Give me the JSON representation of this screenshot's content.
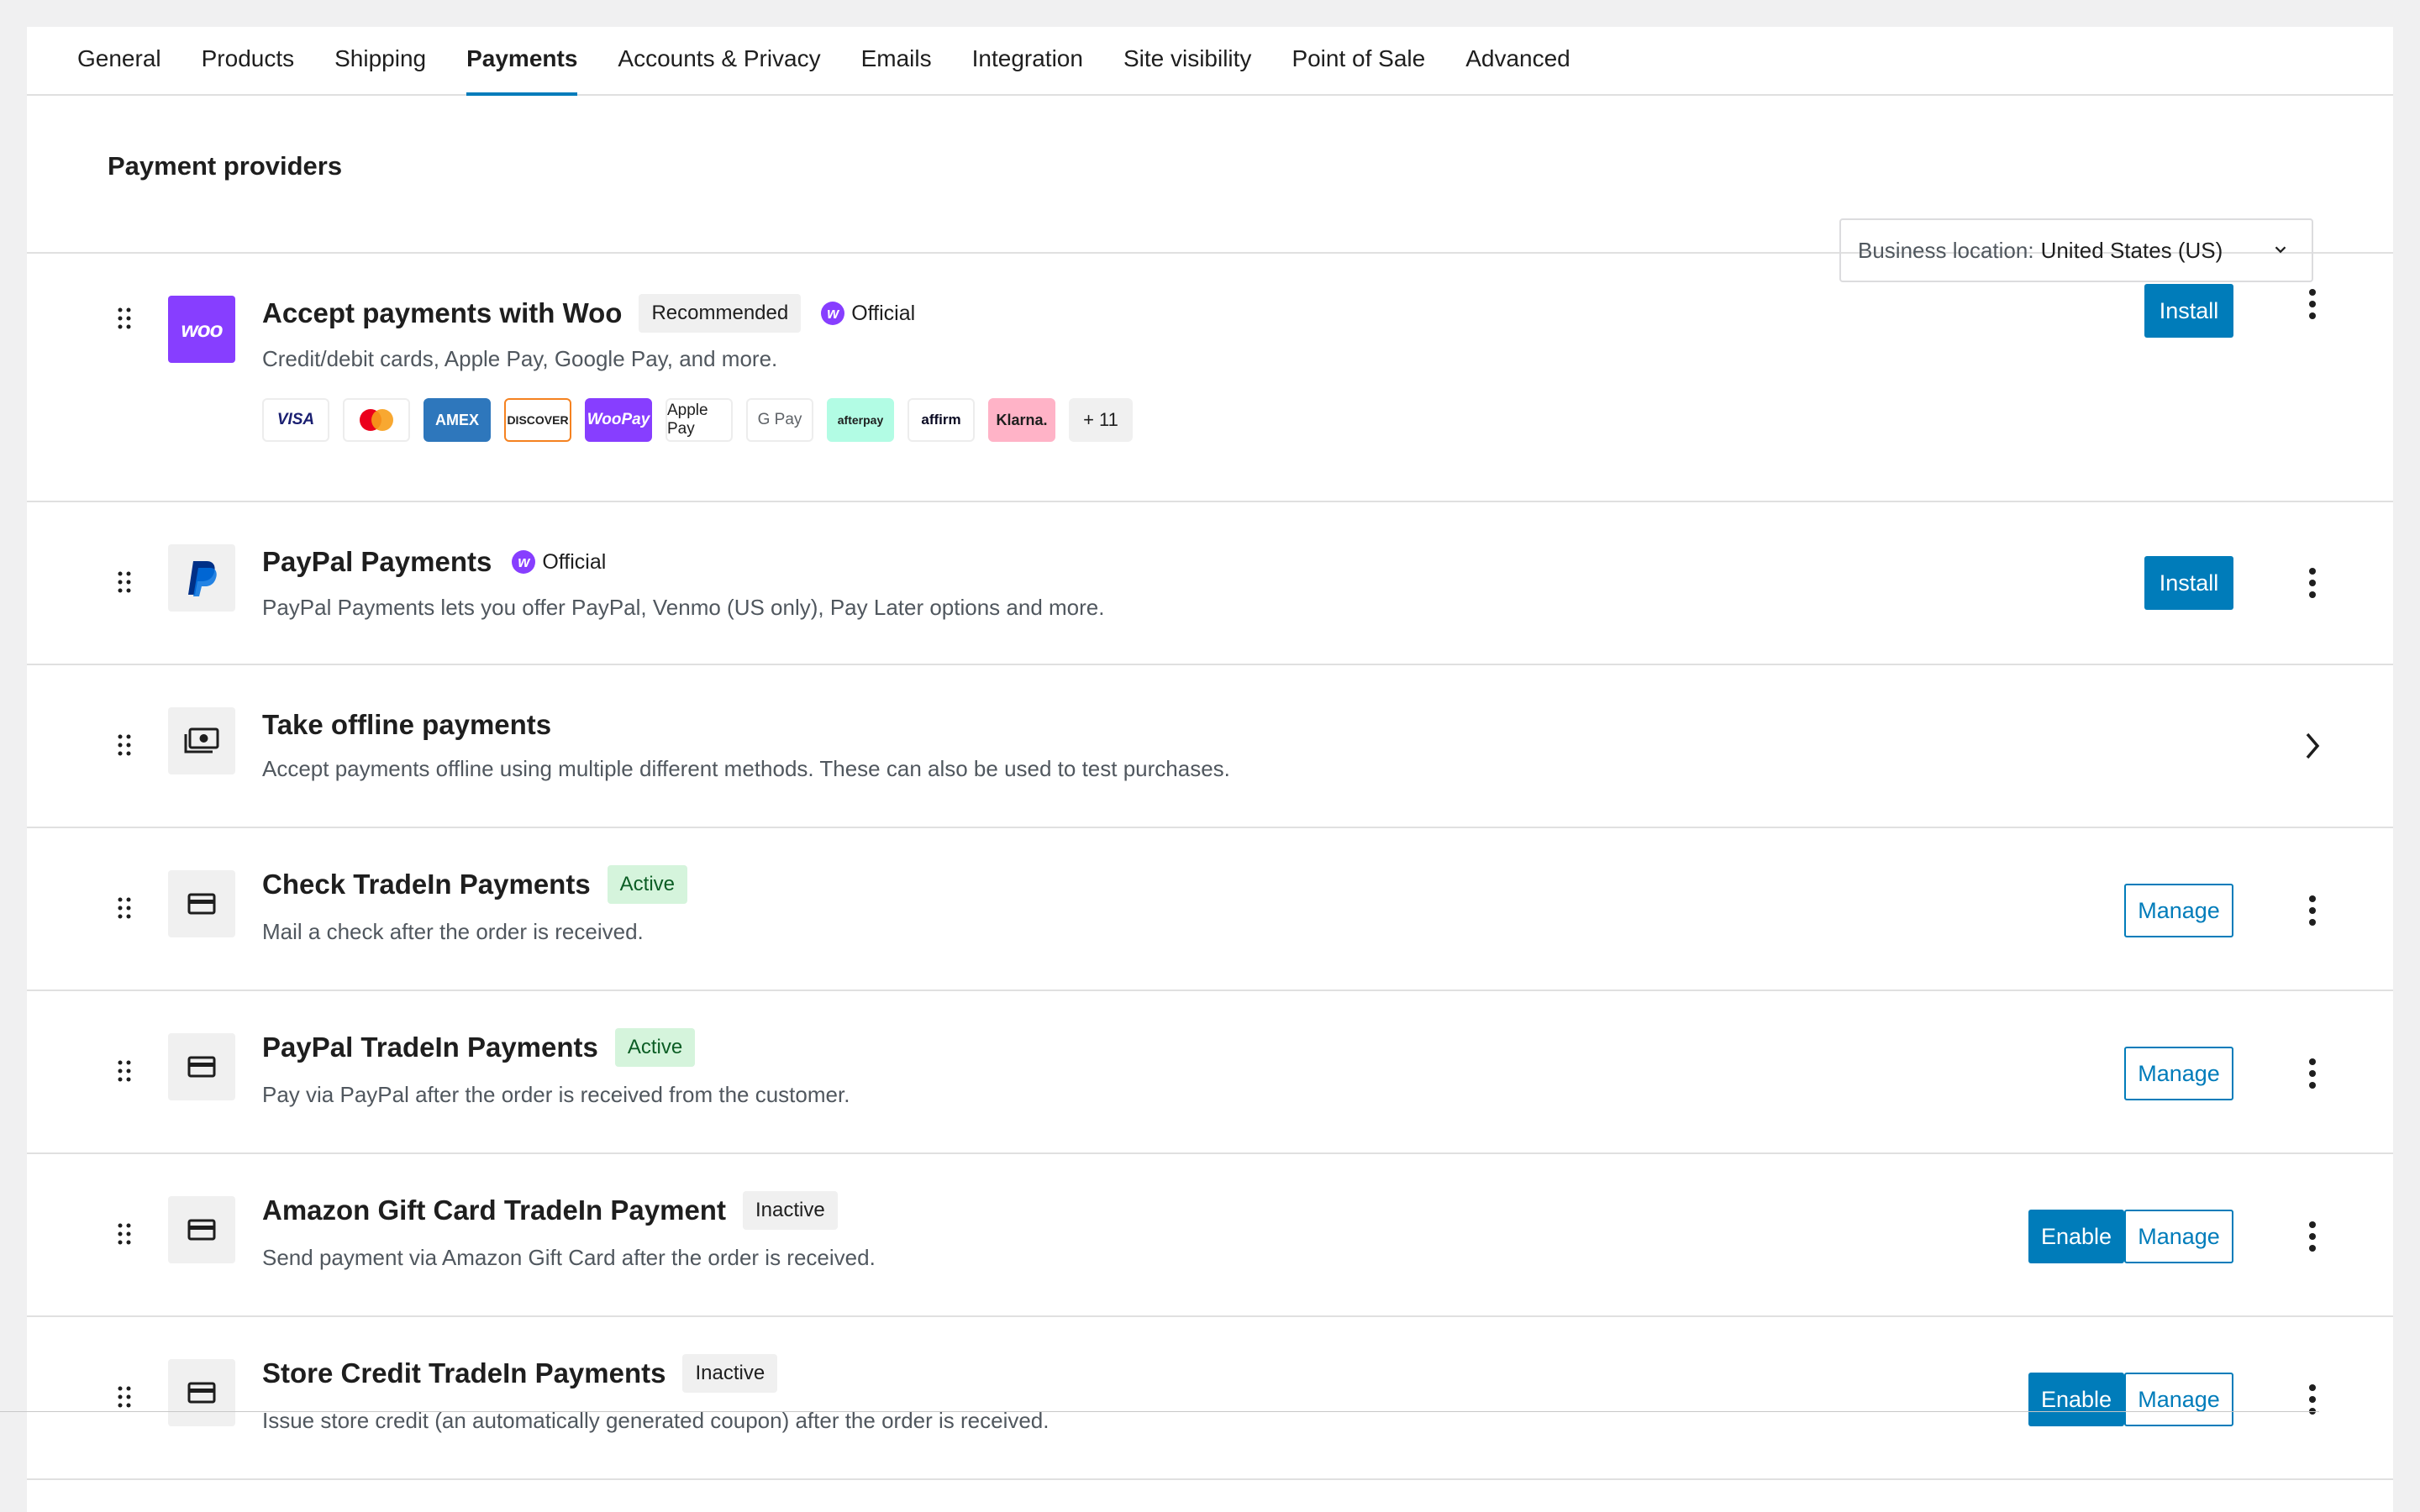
{
  "tabs": [
    {
      "label": "General"
    },
    {
      "label": "Products"
    },
    {
      "label": "Shipping"
    },
    {
      "label": "Payments"
    },
    {
      "label": "Accounts & Privacy"
    },
    {
      "label": "Emails"
    },
    {
      "label": "Integration"
    },
    {
      "label": "Site visibility"
    },
    {
      "label": "Point of Sale"
    },
    {
      "label": "Advanced"
    }
  ],
  "active_tab": "Payments",
  "providers_header": {
    "title": "Payment providers",
    "location_label": "Business location:",
    "location_value": "United States (US)"
  },
  "providers": [
    {
      "name": "Accept payments with Woo",
      "badge": "Recommended",
      "official": "Official",
      "description": "Credit/debit cards, Apple Pay, Google Pay, and more.",
      "icon": "woo",
      "icon_text": "woo",
      "methods": [
        "VISA",
        "Mastercard",
        "AMEX",
        "DISCOVER",
        "WooPay",
        "Apple Pay",
        "G Pay",
        "afterpay",
        "affirm",
        "Klarna.",
        "+ 11"
      ],
      "install_label": "Install"
    },
    {
      "name": "PayPal Payments",
      "official": "Official",
      "description": "PayPal Payments lets you offer PayPal, Venmo (US only), Pay Later options and more.",
      "icon": "paypal-icon",
      "install_label": "Install"
    },
    {
      "name": "Take offline payments",
      "description": "Accept payments offline using multiple different methods. These can also be used to test purchases.",
      "icon": "money-icon"
    },
    {
      "name": "Check TradeIn Payments",
      "badge": "Active",
      "description": "Mail a check after the order is received.",
      "icon": "card-icon",
      "manage_label": "Manage"
    },
    {
      "name": "PayPal TradeIn Payments",
      "badge": "Active",
      "description": "Pay via PayPal after the order is received from the customer.",
      "icon": "card-icon",
      "manage_label": "Manage"
    },
    {
      "name": "Amazon Gift Card TradeIn Payment",
      "badge": "Inactive",
      "description": "Send payment via Amazon Gift Card after the order is received.",
      "icon": "card-icon",
      "enable_label": "Enable",
      "manage_label": "Manage"
    },
    {
      "name": "Store Credit TradeIn Payments",
      "badge": "Inactive",
      "description": "Issue store credit (an automatically generated coupon) after the order is received.",
      "icon": "card-icon",
      "enable_label": "Enable",
      "manage_label": "Manage"
    }
  ],
  "colors": {
    "accent": "#007cba",
    "woo_purple": "#873eff",
    "active_badge_bg": "#d5f4dc",
    "neutral_badge_bg": "#f0f0f0"
  }
}
